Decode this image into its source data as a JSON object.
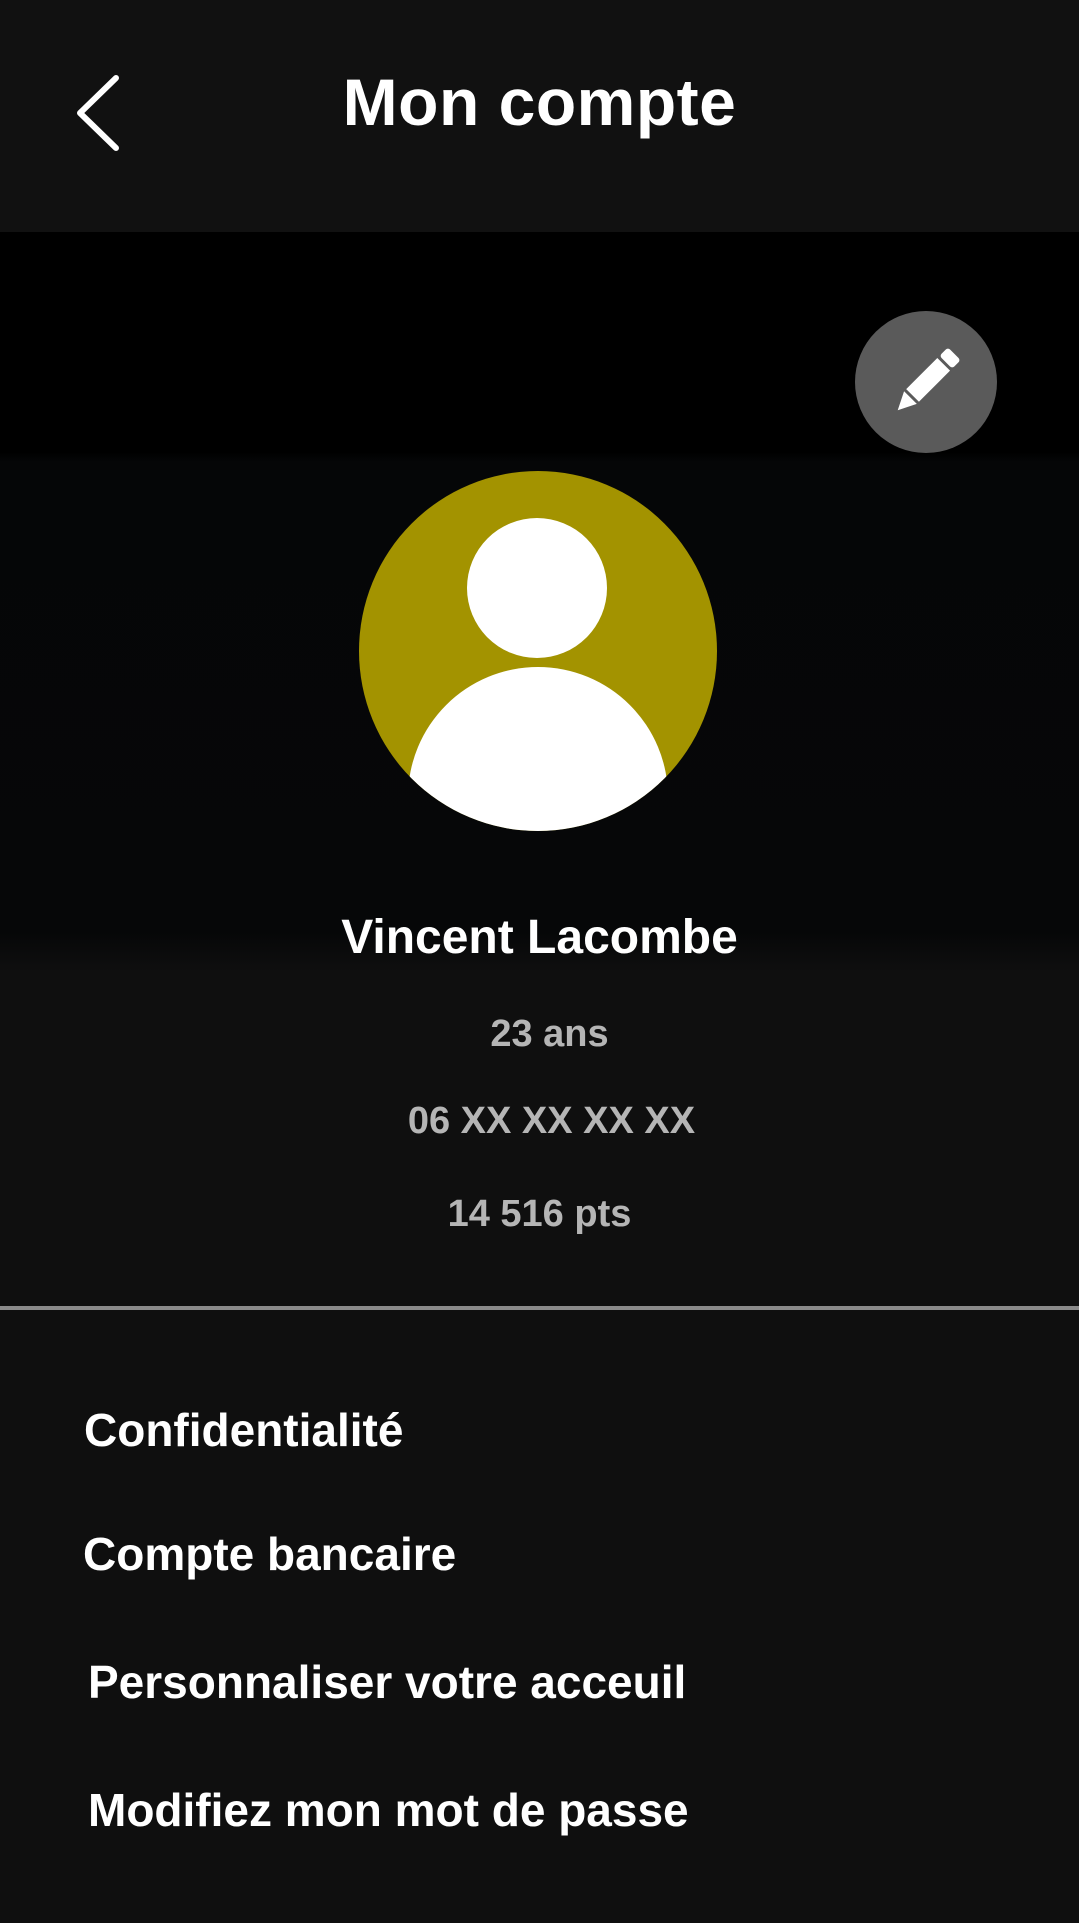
{
  "header": {
    "title": "Mon compte",
    "back_icon": "chevron-left-icon"
  },
  "profile": {
    "edit_icon": "pencil-icon",
    "avatar_icon": "user-avatar-icon",
    "avatar_color": "#a39300",
    "name": "Vincent Lacombe",
    "age": "23 ans",
    "phone": "06 XX XX XX XX",
    "points": "14 516 pts"
  },
  "menu": {
    "items": [
      {
        "label": "Confidentialité"
      },
      {
        "label": "Compte bancaire"
      },
      {
        "label": "Personnaliser votre acceuil"
      },
      {
        "label": "Modifiez mon mot de passe"
      }
    ]
  }
}
